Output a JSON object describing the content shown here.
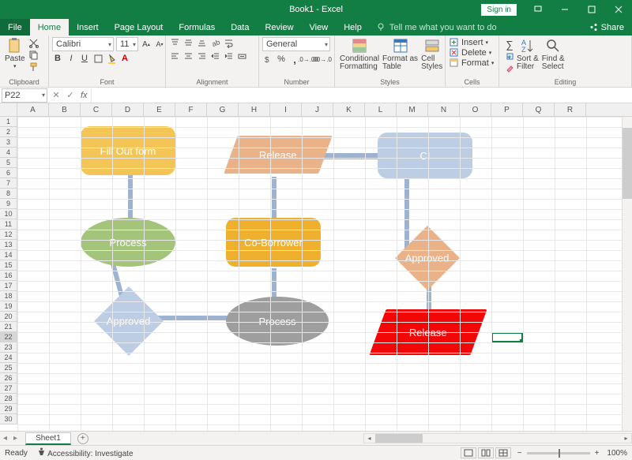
{
  "titlebar": {
    "title": "Book1 - Excel",
    "signin": "Sign in"
  },
  "tabs": {
    "file": "File",
    "items": [
      "Home",
      "Insert",
      "Page Layout",
      "Formulas",
      "Data",
      "Review",
      "View",
      "Help"
    ],
    "active": "Home",
    "tellme": "Tell me what you want to do",
    "share": "Share"
  },
  "ribbon": {
    "clipboard": {
      "paste": "Paste",
      "label": "Clipboard"
    },
    "font": {
      "name": "Calibri",
      "size": "11",
      "label": "Font"
    },
    "alignment": {
      "label": "Alignment"
    },
    "number": {
      "format": "General",
      "label": "Number"
    },
    "styles": {
      "cond": "Conditional\nFormatting",
      "table": "Format as\nTable",
      "cell": "Cell\nStyles",
      "label": "Styles"
    },
    "cells": {
      "insert": "Insert",
      "delete": "Delete",
      "format": "Format",
      "label": "Cells"
    },
    "editing": {
      "sort": "Sort &\nFilter",
      "find": "Find &\nSelect",
      "label": "Editing"
    }
  },
  "formulabar": {
    "namebox": "P22",
    "fx": "fx"
  },
  "grid": {
    "cols": [
      "A",
      "B",
      "C",
      "D",
      "E",
      "F",
      "G",
      "H",
      "I",
      "J",
      "K",
      "L",
      "M",
      "N",
      "O",
      "P",
      "Q",
      "R"
    ],
    "row_count": 30,
    "selected": {
      "col": "P",
      "row": 22
    }
  },
  "flowchart": {
    "fillout": "Fill Out form",
    "process1": "Process",
    "release1": "Release",
    "coborrower": "Co-Borrower",
    "ci": "CI",
    "approved1": "Approved",
    "process2": "Process",
    "approved2": "Approved",
    "release2": "Release"
  },
  "sheets": {
    "active": "Sheet1"
  },
  "status": {
    "ready": "Ready",
    "access": "Accessibility: Investigate",
    "zoom": "100%"
  }
}
